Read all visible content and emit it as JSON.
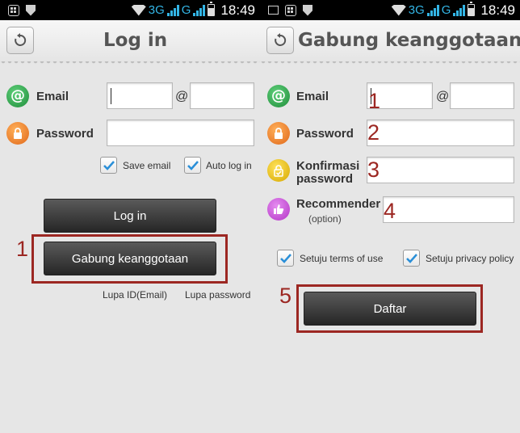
{
  "status_bar": {
    "network": "3G",
    "signal": "G",
    "time": "18:49"
  },
  "left_screen": {
    "title": "Log in",
    "email_label": "Email",
    "email_at": "@",
    "password_label": "Password",
    "save_email_label": "Save email",
    "auto_login_label": "Auto log in",
    "login_button": "Log in",
    "join_button": "Gabung keanggotaan",
    "forgot_id_link": "Lupa ID(Email)",
    "forgot_password_link": "Lupa password"
  },
  "right_screen": {
    "title": "Gabung keanggotaan",
    "email_label": "Email",
    "email_at": "@",
    "password_label": "Password",
    "confirm_label_line1": "Konfirmasi",
    "confirm_label_line2": "password",
    "recommender_label": "Recommender",
    "recommender_option": "(option)",
    "terms_label": "Setuju terms of use",
    "privacy_label": "Setuju privacy policy",
    "register_button": "Daftar"
  },
  "annotations": {
    "left_join": "1",
    "email": "1",
    "password": "2",
    "confirm": "3",
    "recommender": "4",
    "register": "5"
  },
  "colors": {
    "annotation_red": "#9c2722",
    "checkmark_blue": "#2a8fd8"
  }
}
